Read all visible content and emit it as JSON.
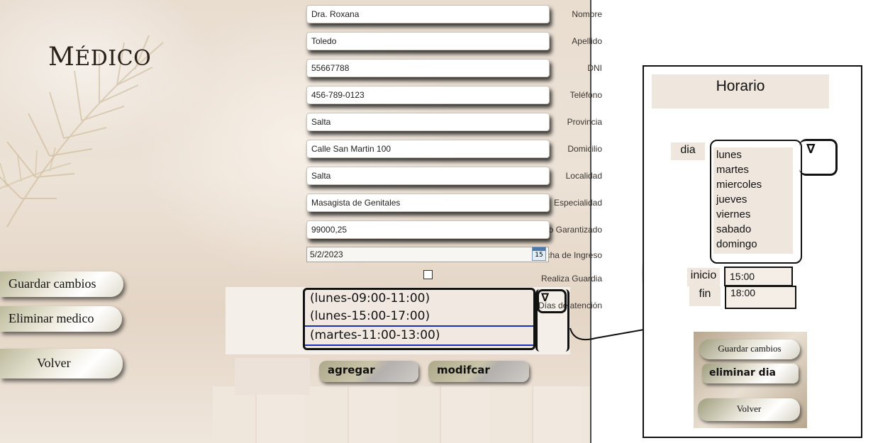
{
  "title": {
    "first": "M",
    "rest": "ÉDICO"
  },
  "fields": [
    {
      "label": "Nombre",
      "value": "Dra. Roxana"
    },
    {
      "label": "Apellido",
      "value": "Toledo"
    },
    {
      "label": "DNI",
      "value": "55667788"
    },
    {
      "label": "Teléfono",
      "value": "456-789-0123"
    },
    {
      "label": "Provincia",
      "value": "Salta"
    },
    {
      "label": "Domicilio",
      "value": "Calle San Martin 100"
    },
    {
      "label": "Localidad",
      "value": "Salta"
    },
    {
      "label": "Especialidad",
      "value": "Masagista de Genitales"
    },
    {
      "label": "Sueldo Minimo Garantizado",
      "value": "99000,25"
    }
  ],
  "fecha": {
    "label": "Fecha de Ingreso",
    "value": "5/2/2023",
    "calendar_day": "15",
    "icon": "calendar-icon"
  },
  "guardia": {
    "label": "Realiza Guardia",
    "checked": false
  },
  "dias": {
    "label": "Días de atención",
    "items": [
      "(lunes-09:00-11:00)",
      "(lunes-15:00-17:00)",
      "(martes-11:00-13:00)"
    ],
    "dropdown_glyph": "∇"
  },
  "side_buttons": {
    "guardar": "Guardar cambios",
    "eliminar": "Eliminar medico",
    "volver": "Volver"
  },
  "action_buttons": {
    "agregar": "agregar",
    "modificar": "modifcar"
  },
  "horario": {
    "title": "Horario",
    "dia_label": "dia",
    "dias": [
      "lunes",
      "martes",
      "miercoles",
      "jueves",
      "viernes",
      "sabado",
      "domingo"
    ],
    "dropdown_glyph": "∇",
    "inicio_label": "inicio",
    "inicio_value": "15:00",
    "fin_label": "fin",
    "fin_value": "18:00",
    "buttons": {
      "guardar": "Guardar cambios",
      "eliminar": "eliminar dia",
      "volver": "Volver"
    }
  },
  "colors": {
    "accent_border": "#111111",
    "selection": "#1a2fb3",
    "panel_beige": "#efe6de"
  }
}
